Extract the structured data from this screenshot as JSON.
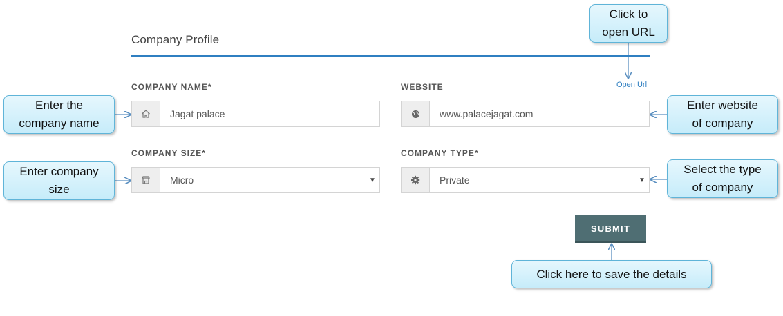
{
  "form": {
    "section_title": "Company Profile",
    "company_name": {
      "label": "COMPANY NAME*",
      "value": "Jagat palace",
      "icon": "home-icon"
    },
    "website": {
      "label": "WEBSITE",
      "value": "www.palacejagat.com",
      "icon": "globe-icon",
      "open_url": "Open Url"
    },
    "company_size": {
      "label": "COMPANY SIZE*",
      "value": "Micro",
      "icon": "building-icon",
      "arrow": "▼"
    },
    "company_type": {
      "label": "COMPANY TYPE*",
      "value": "Private",
      "icon": "gear-icon",
      "arrow": "▼"
    },
    "submit_label": "SUBMIT"
  },
  "annotations": {
    "open_url": [
      "Click to",
      "open URL"
    ],
    "company_name": [
      "Enter the",
      "company name"
    ],
    "website": [
      "Enter website",
      "of company"
    ],
    "company_size": [
      "Enter company",
      "size"
    ],
    "company_type": [
      "Select the type",
      "of company"
    ],
    "submit": [
      "Click here to save the details"
    ]
  },
  "colors": {
    "accent": "#2f7fc1",
    "submit_bg": "#4f6e73",
    "callout_bg": "#c6ecfa",
    "callout_border": "#5fb4d8"
  }
}
